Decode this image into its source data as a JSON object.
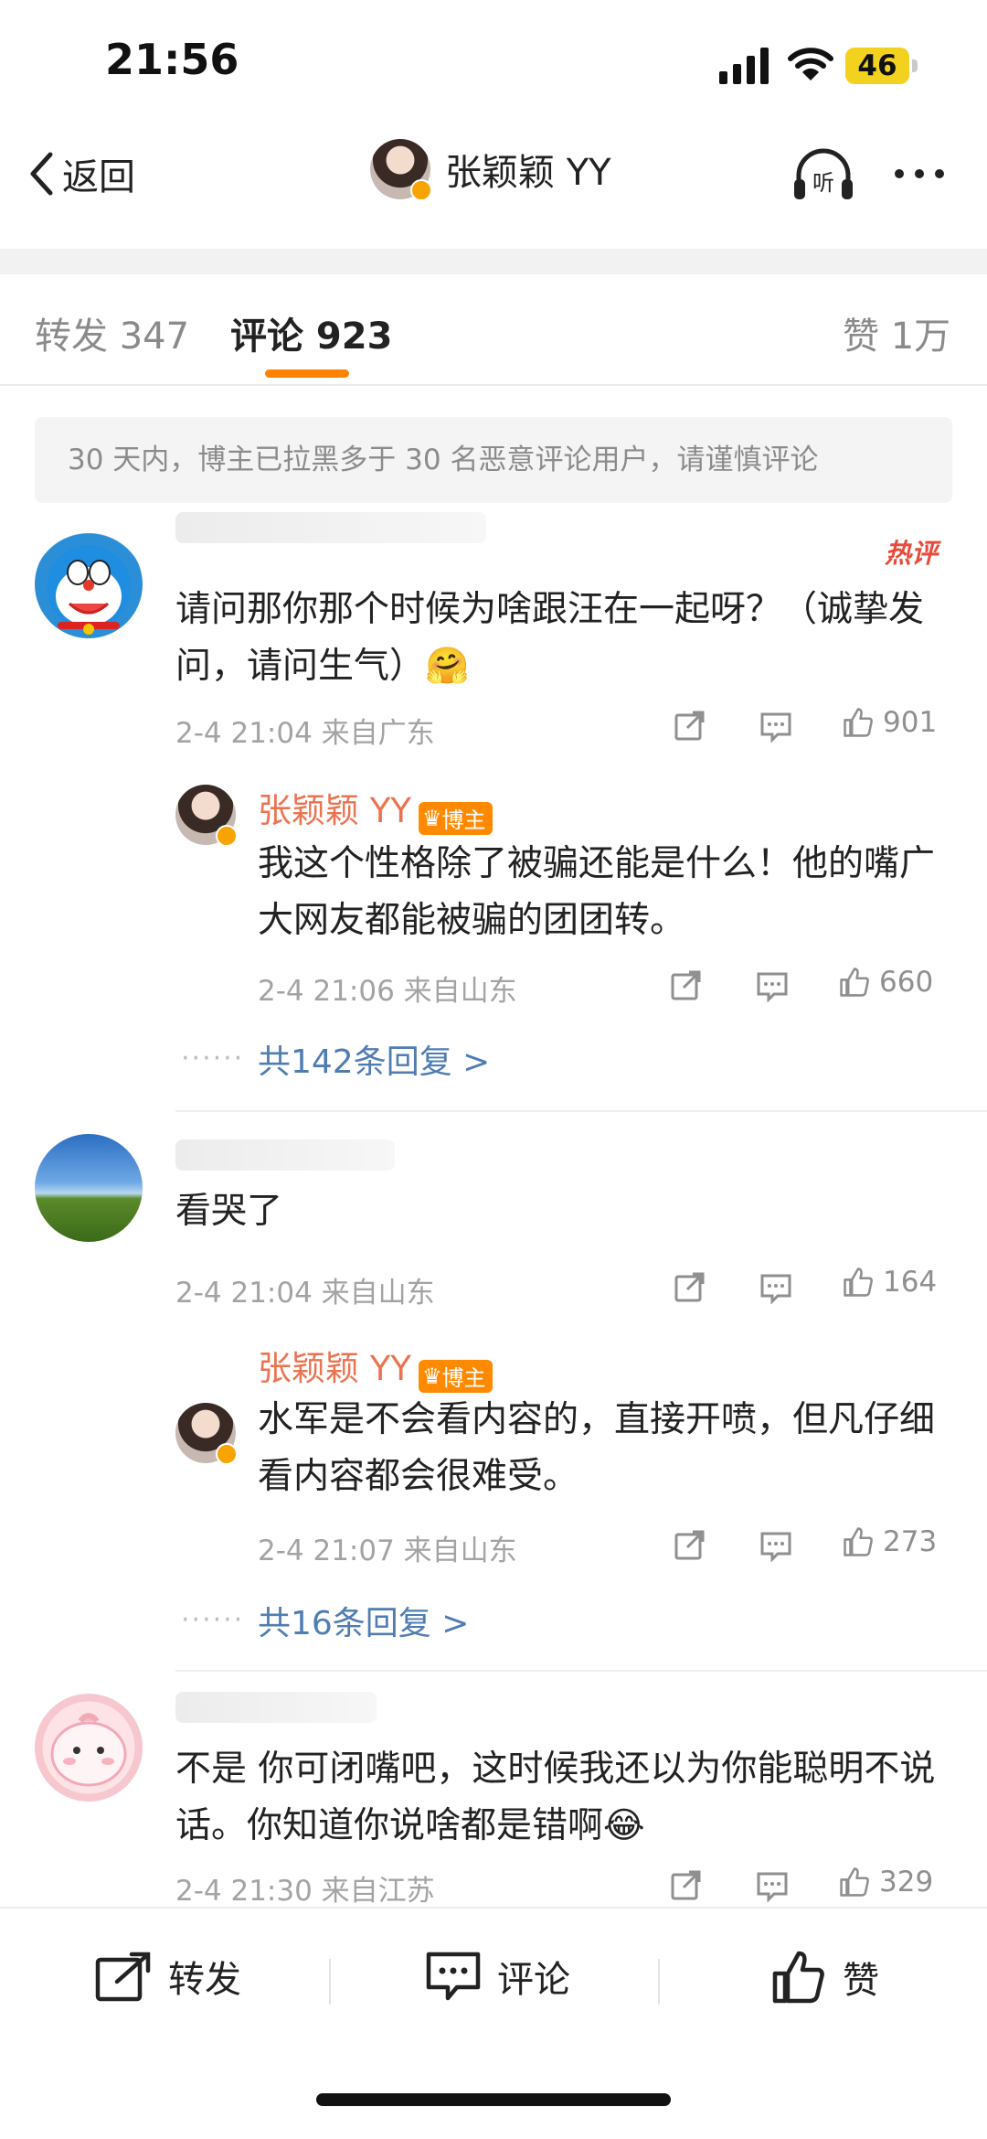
{
  "status_bar": {
    "time": "21:56",
    "battery": "46"
  },
  "nav": {
    "back_label": "返回",
    "user_name": "张颖颖 YY",
    "listen_icon": "listen-icon",
    "more_icon": "more-icon"
  },
  "tabs": {
    "repost": "转发 347",
    "comment": "评论 923",
    "like": "赞 1万"
  },
  "notice": "30 天内，博主已拉黑多于 30 名恶意评论用户，请谨慎评论",
  "hot_badge": "热评",
  "comments": [
    {
      "text": "请问那你那个时候为啥跟汪在一起呀？（诚挚发问，请问生气）",
      "emoji": "🤗",
      "meta": "2-4 21:04  来自广东",
      "likes": "901",
      "reply": {
        "name": "张颖颖 YY",
        "badge": "博主",
        "text": "我这个性格除了被骗还能是什么！他的嘴广大网友都能被骗的团团转。",
        "meta": "2-4 21:06  来自山东",
        "likes": "660"
      },
      "more_replies": "共142条回复 >"
    },
    {
      "text": "看哭了",
      "meta": "2-4 21:04  来自山东",
      "likes": "164",
      "reply": {
        "name": "张颖颖 YY",
        "badge": "博主",
        "text": "水军是不会看内容的，直接开喷，但凡仔细看内容都会很难受。",
        "meta": "2-4 21:07  来自山东",
        "likes": "273"
      },
      "more_replies": "共16条回复 >"
    },
    {
      "text": "不是 你可闭嘴吧，这时候我还以为你能聪明不说话。你知道你说啥都是错啊",
      "emoji": "😂",
      "meta": "2-4 21:30  来自江苏",
      "likes": "329"
    }
  ],
  "bottom_bar": {
    "repost": "转发",
    "comment": "评论",
    "like": "赞"
  },
  "colors": {
    "accent": "#ff8200",
    "reply_name": "#eb7350",
    "link": "#4f7db3",
    "hot": "#e84b3c"
  }
}
